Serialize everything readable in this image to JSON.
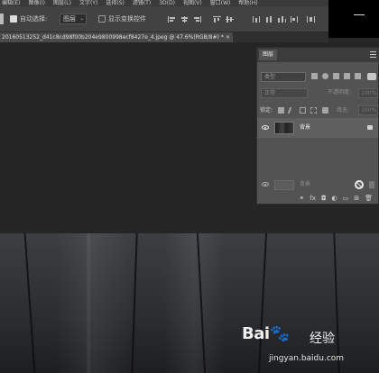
{
  "menu": {
    "items": [
      "编辑(E)",
      "图像(I)",
      "图层(L)",
      "文字(Y)",
      "选择(S)",
      "滤镜(T)",
      "3D(D)",
      "视图(V)",
      "窗口(W)",
      "帮助(H)"
    ]
  },
  "options_bar": {
    "auto_select_label": "自动选择:",
    "auto_select_value": "图层",
    "show_transform_label": "显示变换控件"
  },
  "document": {
    "tab_title": "20160513252_d41c8cd98f00b204e9800998ecf8427e_4.jpeg @ 47.6%(RGB/8#) *",
    "close_glyph": "×"
  },
  "layers_panel": {
    "title": "图层",
    "filter_placeholder": "类型",
    "blend_mode": "正常",
    "opacity_label": "不透明度:",
    "opacity_value": "100%",
    "lock_label": "锁定:",
    "fill_label": "填充:",
    "fill_value": "100%",
    "layers": [
      {
        "name": "背景",
        "visible": true,
        "locked": true
      }
    ],
    "ghost_layer_name": "背景",
    "footer_icons": [
      "link-icon",
      "fx-icon",
      "mask-icon",
      "adjustment-icon",
      "group-icon",
      "new-layer-icon",
      "trash-icon"
    ],
    "footer_glyphs": [
      "⚭",
      "fx",
      "◘",
      "◐",
      "▭",
      "⊞",
      "🗑"
    ]
  },
  "watermark": {
    "logo": "Bai",
    "logo_paw": "🐾",
    "suffix": "经验",
    "url": "jingyan.baidu.com"
  },
  "colors": {
    "menu_bg": "#3a3a3a",
    "options_bg": "#424242",
    "panel_bg": "#535353",
    "selected_layer_bg": "#5f5f5f",
    "canvas_dark": "#1d1e20"
  }
}
